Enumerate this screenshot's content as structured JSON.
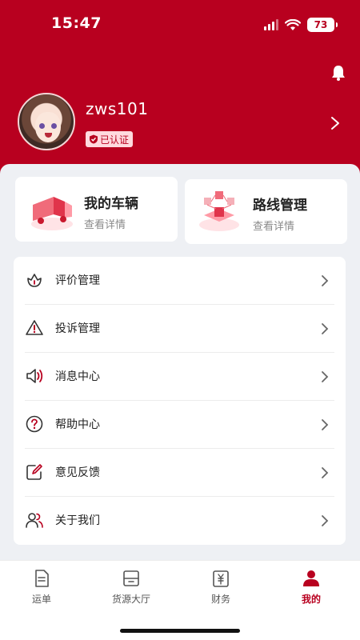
{
  "status_bar": {
    "time": "15:47",
    "battery": "73"
  },
  "profile": {
    "username": "zws101",
    "badge": "已认证"
  },
  "cards": [
    {
      "title": "我的车辆",
      "subtitle": "查看详情"
    },
    {
      "title": "路线管理",
      "subtitle": "查看详情"
    }
  ],
  "menu": [
    {
      "label": "评价管理",
      "icon": "flower-icon"
    },
    {
      "label": "投诉管理",
      "icon": "warning-icon"
    },
    {
      "label": "消息中心",
      "icon": "speaker-icon"
    },
    {
      "label": "帮助中心",
      "icon": "help-icon"
    },
    {
      "label": "意见反馈",
      "icon": "edit-icon"
    },
    {
      "label": "关于我们",
      "icon": "users-icon"
    }
  ],
  "tabs": [
    {
      "label": "运单",
      "icon": "document-icon",
      "active": false
    },
    {
      "label": "货源大厅",
      "icon": "cargo-icon",
      "active": false
    },
    {
      "label": "财务",
      "icon": "yen-icon",
      "active": false
    },
    {
      "label": "我的",
      "icon": "person-icon",
      "active": true
    }
  ],
  "colors": {
    "brand": "#b8001f",
    "background": "#eef0f4",
    "accent_light": "#ffd9de"
  }
}
